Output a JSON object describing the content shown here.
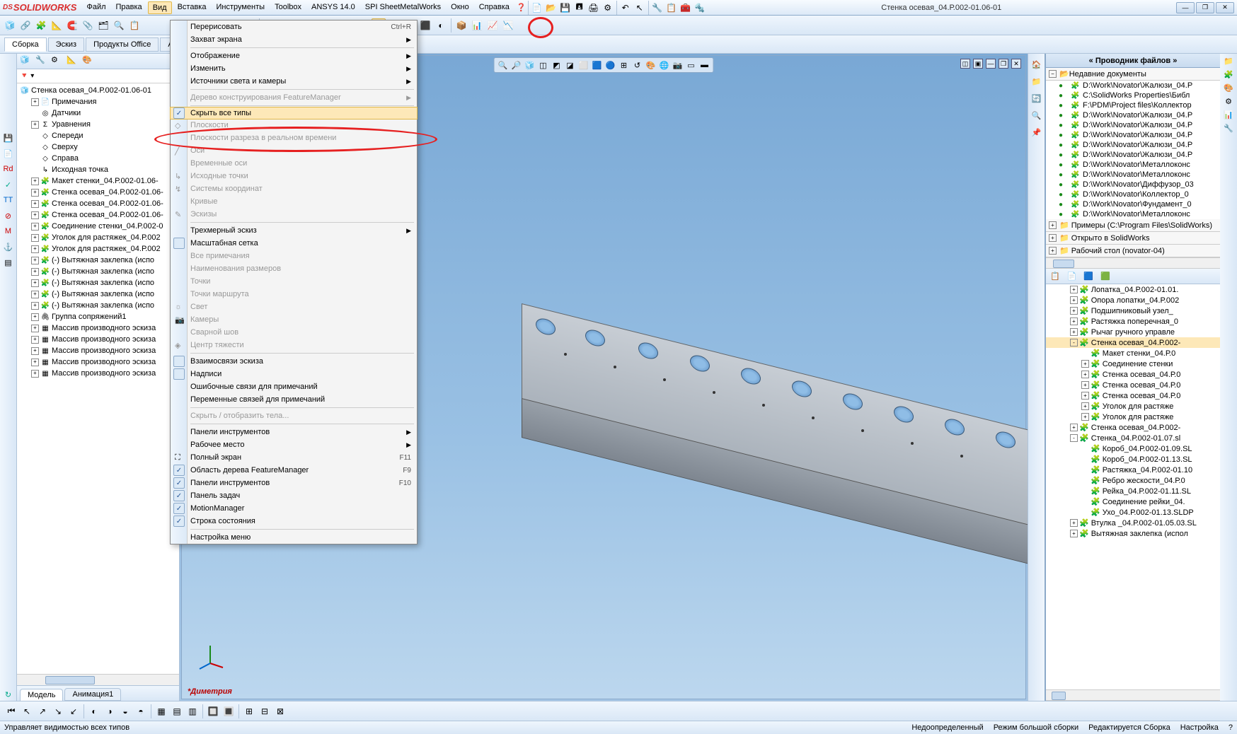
{
  "app_name": "SOLIDWORKS",
  "doc_title": "Стенка осевая_04.Р.002-01.06-01",
  "menubar": [
    "Файл",
    "Правка",
    "Вид",
    "Вставка",
    "Инструменты",
    "Toolbox",
    "ANSYS 14.0",
    "SPI SheetMetalWorks",
    "Окно",
    "Справка"
  ],
  "menubar_active_index": 2,
  "task_tabs": [
    "Сборка",
    "Эскиз",
    "Продукты Office",
    "A"
  ],
  "view_menu": {
    "items": [
      {
        "label": "Перерисовать",
        "shortcut": "Ctrl+R",
        "type": "item"
      },
      {
        "label": "Захват экрана",
        "type": "sub"
      },
      {
        "type": "sep"
      },
      {
        "label": "Отображение",
        "type": "sub"
      },
      {
        "label": "Изменить",
        "type": "sub"
      },
      {
        "label": "Источники света и камеры",
        "type": "sub"
      },
      {
        "type": "sep"
      },
      {
        "label": "Дерево конструирования FeatureManager",
        "type": "sub",
        "disabled": true
      },
      {
        "type": "sep"
      },
      {
        "label": "Скрыть все типы",
        "type": "check",
        "checked": true,
        "highlight": true
      },
      {
        "label": "Плоскости",
        "type": "item",
        "disabled": true,
        "icon": "◇"
      },
      {
        "label": "Плоскости разреза в реальном времени",
        "type": "item",
        "disabled": true
      },
      {
        "label": "Оси",
        "type": "item",
        "disabled": true,
        "icon": "╱"
      },
      {
        "label": "Временные оси",
        "type": "item",
        "disabled": true
      },
      {
        "label": "Исходные точки",
        "type": "item",
        "disabled": true,
        "icon": "↳"
      },
      {
        "label": "Системы координат",
        "type": "item",
        "disabled": true,
        "icon": "↯"
      },
      {
        "label": "Кривые",
        "type": "item",
        "disabled": true
      },
      {
        "label": "Эскизы",
        "type": "item",
        "disabled": true,
        "icon": "✎"
      },
      {
        "type": "sep"
      },
      {
        "label": "Трехмерный эскиз",
        "type": "sub"
      },
      {
        "label": "Масштабная сетка",
        "type": "check",
        "checked": false
      },
      {
        "label": "Все примечания",
        "type": "item",
        "disabled": true
      },
      {
        "label": "Наименования размеров",
        "type": "item",
        "disabled": true
      },
      {
        "label": "Точки",
        "type": "item",
        "disabled": true
      },
      {
        "label": "Точки маршрута",
        "type": "item",
        "disabled": true
      },
      {
        "label": "Свет",
        "type": "item",
        "disabled": true,
        "icon": "☼"
      },
      {
        "label": "Камеры",
        "type": "item",
        "disabled": true,
        "icon": "📷"
      },
      {
        "label": "Сварной шов",
        "type": "item",
        "disabled": true
      },
      {
        "label": "Центр тяжести",
        "type": "item",
        "disabled": true,
        "icon": "◈"
      },
      {
        "type": "sep"
      },
      {
        "label": "Взаимосвязи эскиза",
        "type": "check",
        "checked": false,
        "icon": "⊥"
      },
      {
        "label": "Надписи",
        "type": "check",
        "checked": false
      },
      {
        "label": "Ошибочные связи для примечаний",
        "type": "item"
      },
      {
        "label": "Переменные связей для примечаний",
        "type": "item"
      },
      {
        "type": "sep"
      },
      {
        "label": "Скрыть / отобразить тела...",
        "type": "item",
        "disabled": true
      },
      {
        "type": "sep"
      },
      {
        "label": "Панели инструментов",
        "type": "sub"
      },
      {
        "label": "Рабочее место",
        "type": "sub"
      },
      {
        "label": "Полный экран",
        "shortcut": "F11",
        "type": "item",
        "icon": "⛶"
      },
      {
        "label": "Область дерева FeatureManager",
        "shortcut": "F9",
        "type": "check",
        "checked": true
      },
      {
        "label": "Панели инструментов",
        "shortcut": "F10",
        "type": "check",
        "checked": true
      },
      {
        "label": "Панель задач",
        "type": "check",
        "checked": true
      },
      {
        "label": "MotionManager",
        "type": "check",
        "checked": true
      },
      {
        "label": "Строка состояния",
        "type": "check",
        "checked": true
      },
      {
        "type": "sep"
      },
      {
        "label": "Настройка меню",
        "type": "item"
      }
    ]
  },
  "feature_tree": {
    "root": "Стенка осевая_04.Р.002-01.06-01",
    "items": [
      {
        "label": "Примечания",
        "depth": 1,
        "exp": "+",
        "ico": "📄"
      },
      {
        "label": "Датчики",
        "depth": 1,
        "ico": "◎"
      },
      {
        "label": "Уравнения",
        "depth": 1,
        "exp": "+",
        "ico": "Σ"
      },
      {
        "label": "Спереди",
        "depth": 1,
        "ico": "◇"
      },
      {
        "label": "Сверху",
        "depth": 1,
        "ico": "◇"
      },
      {
        "label": "Справа",
        "depth": 1,
        "ico": "◇"
      },
      {
        "label": "Исходная точка",
        "depth": 1,
        "ico": "↳"
      },
      {
        "label": "Макет стенки_04.Р.002-01.06-",
        "depth": 1,
        "exp": "+",
        "ico": "🧩"
      },
      {
        "label": "Стенка осевая_04.Р.002-01.06-",
        "depth": 1,
        "exp": "+",
        "ico": "🧩"
      },
      {
        "label": "Стенка осевая_04.Р.002-01.06-",
        "depth": 1,
        "exp": "+",
        "ico": "🧩"
      },
      {
        "label": "Стенка осевая_04.Р.002-01.06-",
        "depth": 1,
        "exp": "+",
        "ico": "🧩"
      },
      {
        "label": "Соединение стенки_04.Р.002-0",
        "depth": 1,
        "exp": "+",
        "ico": "🧩"
      },
      {
        "label": "Уголок для растяжек_04.Р.002",
        "depth": 1,
        "exp": "+",
        "ico": "🧩"
      },
      {
        "label": "Уголок для растяжек_04.Р.002",
        "depth": 1,
        "exp": "+",
        "ico": "🧩"
      },
      {
        "label": "(-) Вытяжная заклепка (испо",
        "depth": 1,
        "exp": "+",
        "ico": "🧩"
      },
      {
        "label": "(-) Вытяжная заклепка (испо",
        "depth": 1,
        "exp": "+",
        "ico": "🧩"
      },
      {
        "label": "(-) Вытяжная заклепка (испо",
        "depth": 1,
        "exp": "+",
        "ico": "🧩"
      },
      {
        "label": "(-) Вытяжная заклепка (испо",
        "depth": 1,
        "exp": "+",
        "ico": "🧩"
      },
      {
        "label": "(-) Вытяжная заклепка (испо",
        "depth": 1,
        "exp": "+",
        "ico": "🧩"
      },
      {
        "label": "Группа сопряжений1",
        "depth": 1,
        "exp": "+",
        "ico": "🖇"
      },
      {
        "label": "Массив производного эскиза",
        "depth": 1,
        "exp": "+",
        "ico": "▦"
      },
      {
        "label": "Массив производного эскиза",
        "depth": 1,
        "exp": "+",
        "ico": "▦"
      },
      {
        "label": "Массив производного эскиза",
        "depth": 1,
        "exp": "+",
        "ico": "▦"
      },
      {
        "label": "Массив производного эскиза",
        "depth": 1,
        "exp": "+",
        "ico": "▦"
      },
      {
        "label": "Массив производного эскиза",
        "depth": 1,
        "exp": "+",
        "ico": "▦"
      }
    ]
  },
  "cm_tabs": [
    "Модель",
    "Анимация1"
  ],
  "orientation_label": "*Диметрия",
  "right_panel": {
    "title": "Проводник файлов",
    "section1": "Недавние документы",
    "recent": [
      "D:\\Work\\Novator\\Жалюзи_04.Р",
      "C:\\SolidWorks Properties\\Библ",
      "F:\\PDM\\Project files\\Коллектор",
      "D:\\Work\\Novator\\Жалюзи_04.Р",
      "D:\\Work\\Novator\\Жалюзи_04.Р",
      "D:\\Work\\Novator\\Жалюзи_04.Р",
      "D:\\Work\\Novator\\Жалюзи_04.Р",
      "D:\\Work\\Novator\\Жалюзи_04.Р",
      "D:\\Work\\Novator\\Металлоконс",
      "D:\\Work\\Novator\\Металлоконс",
      "D:\\Work\\Novator\\Диффузор_03",
      "D:\\Work\\Novator\\Коллектор_0",
      "D:\\Work\\Novator\\Фундамент_0",
      "D:\\Work\\Novator\\Металлоконс"
    ],
    "groups": [
      "Примеры (C:\\Program Files\\SolidWorks)",
      "Открыто в SolidWorks",
      "Рабочий стол (novator-04)"
    ],
    "tree": [
      {
        "label": "Лопатка_04.Р.002-01.01.",
        "depth": 0,
        "exp": "+"
      },
      {
        "label": "Опора лопатки_04.Р.002",
        "depth": 0,
        "exp": "+"
      },
      {
        "label": "Подшипниковый узел_",
        "depth": 0,
        "exp": "+"
      },
      {
        "label": "Растяжка поперечная_0",
        "depth": 0,
        "exp": "+"
      },
      {
        "label": "Рычаг ручного управле",
        "depth": 0,
        "exp": "+"
      },
      {
        "label": "Стенка осевая_04.Р.002-",
        "depth": 0,
        "exp": "-",
        "hl": true
      },
      {
        "label": "Макет стенки_04.Р.0",
        "depth": 1
      },
      {
        "label": "Соединение стенки",
        "depth": 1,
        "exp": "+"
      },
      {
        "label": "Стенка осевая_04.Р.0",
        "depth": 1,
        "exp": "+"
      },
      {
        "label": "Стенка осевая_04.Р.0",
        "depth": 1,
        "exp": "+"
      },
      {
        "label": "Стенка осевая_04.Р.0",
        "depth": 1,
        "exp": "+"
      },
      {
        "label": "Уголок для растяже",
        "depth": 1,
        "exp": "+"
      },
      {
        "label": "Уголок для растяже",
        "depth": 1,
        "exp": "+"
      },
      {
        "label": "Стенка осевая_04.Р.002-",
        "depth": 0,
        "exp": "+"
      },
      {
        "label": "Стенка_04.Р.002-01.07.sl",
        "depth": 0,
        "exp": "-"
      },
      {
        "label": "Короб_04.Р.002-01.09.SL",
        "depth": 1
      },
      {
        "label": "Короб_04.Р.002-01.13.SL",
        "depth": 1
      },
      {
        "label": "Растяжка_04.Р.002-01.10",
        "depth": 1
      },
      {
        "label": "Ребро жескости_04.Р.0",
        "depth": 1
      },
      {
        "label": "Рейка_04.Р.002-01.11.SL",
        "depth": 1
      },
      {
        "label": "Соединение рейки_04.",
        "depth": 1
      },
      {
        "label": "Ухо_04.Р.002-01.13.SLDP",
        "depth": 1
      },
      {
        "label": "Втулка _04.Р.002-01.05.03.SL",
        "depth": 0,
        "exp": "+"
      },
      {
        "label": "Вытяжная заклепка (испол",
        "depth": 0,
        "exp": "+"
      }
    ]
  },
  "status": {
    "left": "Управляет видимостью всех типов",
    "right": [
      "Недоопределенный",
      "Режим большой сборки",
      "Редактируется Сборка",
      "Настройка",
      "?"
    ]
  },
  "colors": {
    "accent": "#da2e2e",
    "sel": "#fde8b8"
  }
}
